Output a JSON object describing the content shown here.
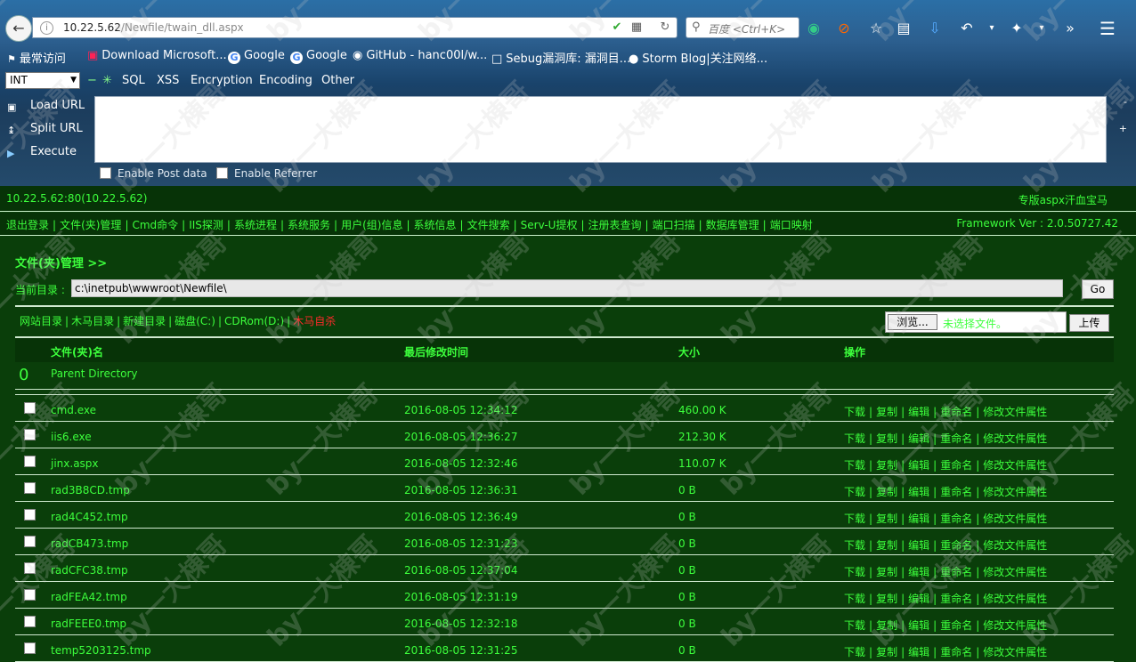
{
  "browser": {
    "url_host": "10.22.5.62",
    "url_path": "/Newfile/twain_dll.aspx",
    "search_placeholder": "百度 <Ctrl+K>",
    "bookmarks": [
      "最常访问",
      "Download Microsoft...",
      "Google",
      "Google",
      "GitHub - hanc00l/w...",
      "Sebug漏洞库: 漏洞目...",
      "Storm Blog|关注网络..."
    ],
    "hackbar": {
      "select_value": "INT",
      "menus": [
        "SQL",
        "XSS",
        "Encryption",
        "Encoding",
        "Other"
      ],
      "actions": [
        "Load URL",
        "Split URL",
        "Execute"
      ],
      "enable_post": "Enable Post data",
      "enable_referrer": "Enable Referrer"
    }
  },
  "shell": {
    "server": "10.22.5.62:80(10.22.5.62)",
    "brand": "专版aspx汗血宝马",
    "menu": [
      "退出登录",
      "文件(夹)管理",
      "Cmd命令",
      "IIS探测",
      "系统进程",
      "系统服务",
      "用户(组)信息",
      "系统信息",
      "文件搜索",
      "Serv-U提权",
      "注册表查询",
      "端口扫描",
      "数据库管理",
      "端口映射"
    ],
    "framework": "Framework Ver : 2.0.50727.42",
    "panel_title": "文件(夹)管理 >>",
    "curdir_label": "当前目录 :",
    "curdir_value": "c:\\inetpub\\wwwroot\\Newfile\\",
    "go_label": "Go",
    "dir_links": [
      "网站目录",
      "木马目录",
      "新建目录",
      "磁盘(C:)",
      "CDRom(D:)"
    ],
    "dir_link_red": "木马自杀",
    "browse_label": "浏览...",
    "no_file": "未选择文件。",
    "upload_label": "上传",
    "table_headers": {
      "name": "文件(夹)名",
      "time": "最后修改时间",
      "size": "大小",
      "ops": "操作"
    },
    "parent_marker": "0",
    "parent_label": "Parent Directory",
    "ops": [
      "下载",
      "复制",
      "编辑",
      "重命名",
      "修改文件属性"
    ],
    "files": [
      {
        "name": "cmd.exe",
        "time": "2016-08-05 12:34:12",
        "size": "460.00 K"
      },
      {
        "name": "iis6.exe",
        "time": "2016-08-05 12:36:27",
        "size": "212.30 K"
      },
      {
        "name": "jinx.aspx",
        "time": "2016-08-05 12:32:46",
        "size": "110.07 K"
      },
      {
        "name": "rad3B8CD.tmp",
        "time": "2016-08-05 12:36:31",
        "size": "0 B"
      },
      {
        "name": "rad4C452.tmp",
        "time": "2016-08-05 12:36:49",
        "size": "0 B"
      },
      {
        "name": "radCB473.tmp",
        "time": "2016-08-05 12:31:23",
        "size": "0 B"
      },
      {
        "name": "radCFC38.tmp",
        "time": "2016-08-05 12:37:04",
        "size": "0 B"
      },
      {
        "name": "radFEA42.tmp",
        "time": "2016-08-05 12:31:19",
        "size": "0 B"
      },
      {
        "name": "radFEEE0.tmp",
        "time": "2016-08-05 12:32:18",
        "size": "0 B"
      },
      {
        "name": "temp5203125.tmp",
        "time": "2016-08-05 12:31:25",
        "size": "0 B"
      }
    ]
  },
  "watermark": "by一大棟哥",
  "colors": {
    "page_bg": "#0a3e0a",
    "text_green": "#3cff3c",
    "danger_red": "#ff2a2a"
  }
}
